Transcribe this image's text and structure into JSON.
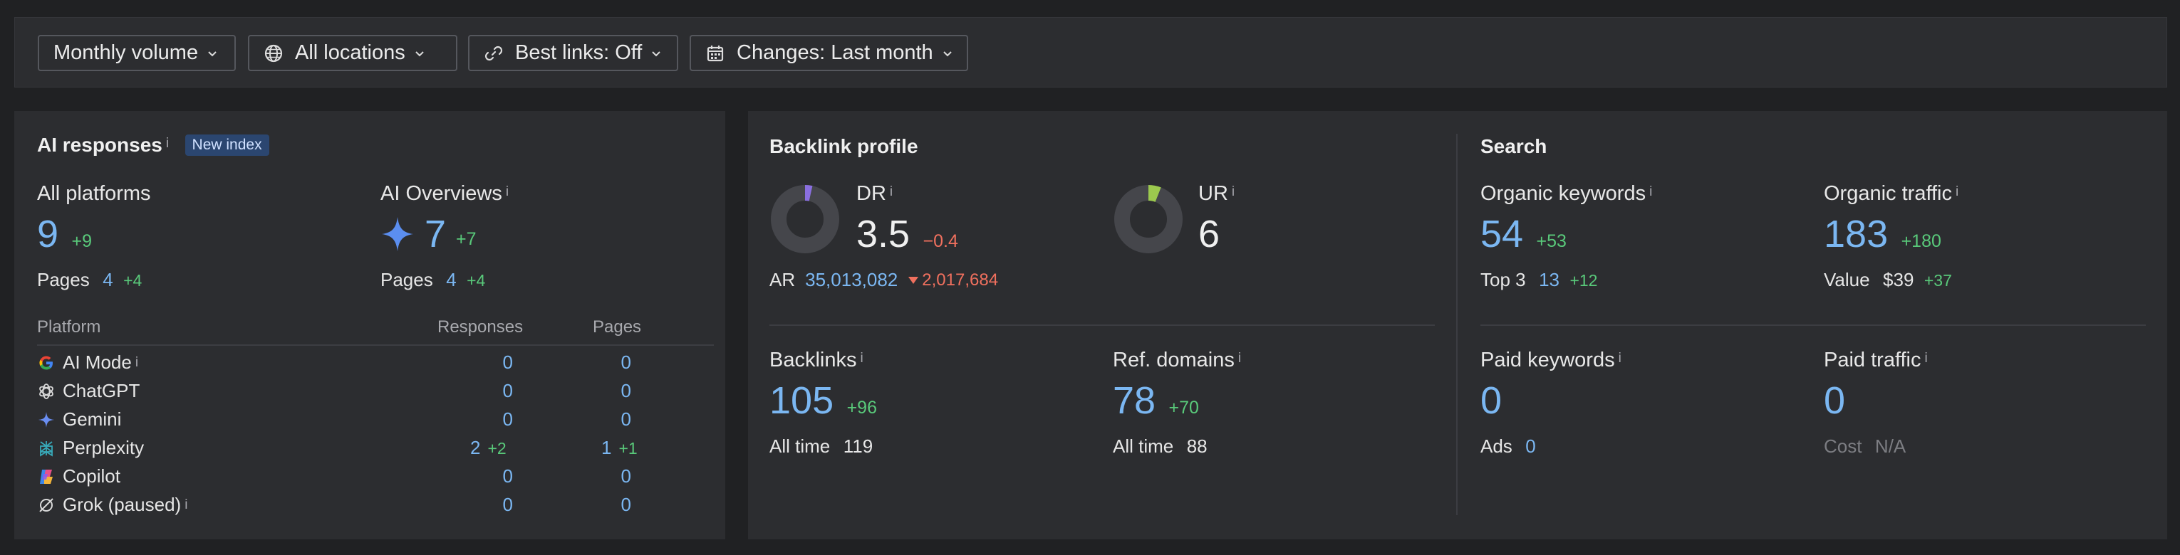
{
  "toolbar": {
    "volume_label": "Monthly volume",
    "locations_label": "All locations",
    "best_links_label": "Best links: Off",
    "changes_label": "Changes: Last month"
  },
  "ai_responses": {
    "title": "AI responses",
    "info": "i",
    "badge": "New index",
    "all_platforms": {
      "label": "All platforms",
      "value": "9",
      "delta": "+9",
      "pages_label": "Pages",
      "pages_value": "4",
      "pages_delta": "+4"
    },
    "ai_overviews": {
      "label": "AI Overviews",
      "value": "7",
      "delta": "+7",
      "pages_label": "Pages",
      "pages_value": "4",
      "pages_delta": "+4"
    },
    "table": {
      "headers": {
        "platform": "Platform",
        "responses": "Responses",
        "pages": "Pages"
      },
      "rows": [
        {
          "name": "AI Mode",
          "info": "i",
          "responses": "0",
          "responses_delta": "",
          "pages": "0",
          "pages_delta": ""
        },
        {
          "name": "ChatGPT",
          "info": "",
          "responses": "0",
          "responses_delta": "",
          "pages": "0",
          "pages_delta": ""
        },
        {
          "name": "Gemini",
          "info": "",
          "responses": "0",
          "responses_delta": "",
          "pages": "0",
          "pages_delta": ""
        },
        {
          "name": "Perplexity",
          "info": "",
          "responses": "2",
          "responses_delta": "+2",
          "pages": "1",
          "pages_delta": "+1"
        },
        {
          "name": "Copilot",
          "info": "",
          "responses": "0",
          "responses_delta": "",
          "pages": "0",
          "pages_delta": ""
        },
        {
          "name": "Grok (paused)",
          "info": "i",
          "responses": "0",
          "responses_delta": "",
          "pages": "0",
          "pages_delta": ""
        }
      ]
    }
  },
  "backlink_profile": {
    "title": "Backlink profile",
    "dr": {
      "label": "DR",
      "info": "i",
      "value": "3.5",
      "delta": "−0.4",
      "ring_fraction": 0.035
    },
    "ur": {
      "label": "UR",
      "info": "i",
      "value": "6",
      "ring_fraction": 0.06
    },
    "ar": {
      "label": "AR",
      "value": "35,013,082",
      "delta": "2,017,684"
    },
    "backlinks": {
      "label": "Backlinks",
      "info": "i",
      "value": "105",
      "delta": "+96",
      "all_time_label": "All time",
      "all_time_value": "119"
    },
    "ref_domains": {
      "label": "Ref. domains",
      "info": "i",
      "value": "78",
      "delta": "+70",
      "all_time_label": "All time",
      "all_time_value": "88"
    }
  },
  "search": {
    "title": "Search",
    "organic_keywords": {
      "label": "Organic keywords",
      "info": "i",
      "value": "54",
      "delta": "+53",
      "sub_label": "Top 3",
      "sub_value": "13",
      "sub_delta": "+12"
    },
    "organic_traffic": {
      "label": "Organic traffic",
      "info": "i",
      "value": "183",
      "delta": "+180",
      "sub_label": "Value",
      "sub_value": "$39",
      "sub_delta": "+37"
    },
    "paid_keywords": {
      "label": "Paid keywords",
      "info": "i",
      "value": "0",
      "sub_label": "Ads",
      "sub_value": "0"
    },
    "paid_traffic": {
      "label": "Paid traffic",
      "info": "i",
      "value": "0",
      "sub_label": "Cost",
      "sub_value": "N/A"
    }
  },
  "colors": {
    "accent_blue": "#7bb7f2",
    "positive": "#59c97a",
    "negative": "#f0705e",
    "dr_ring": "#8a6fe0",
    "ur_ring": "#9cc94e",
    "ring_track": "#45464b"
  }
}
